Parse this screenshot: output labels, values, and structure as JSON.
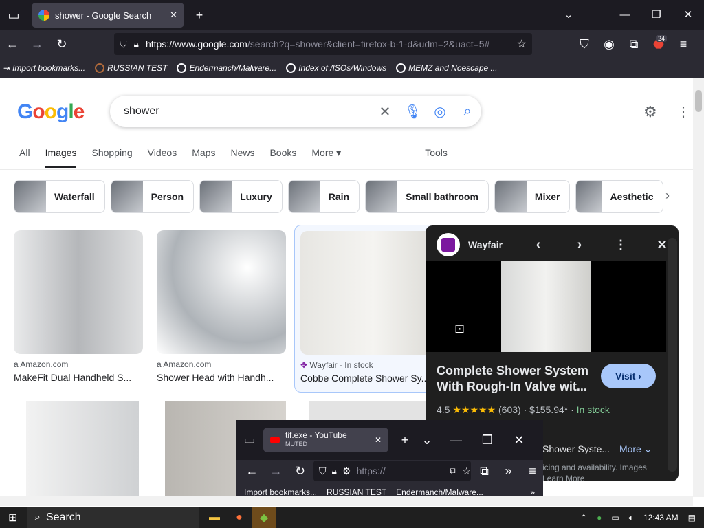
{
  "browser": {
    "tab_title": "shower - Google Search",
    "url_main": "https://www.google.com",
    "url_rest": "/search?q=shower&client=firefox-b-1-d&udm=2&uact=5#",
    "badge_count": "24",
    "bookmarks": [
      "Import bookmarks...",
      "RUSSIAN TEST",
      "Endermanch/Malware...",
      "Index of /ISOs/Windows",
      "MEMZ and Noescape ..."
    ]
  },
  "google": {
    "query": "shower",
    "tabs": [
      "All",
      "Images",
      "Shopping",
      "Videos",
      "Maps",
      "News",
      "Books",
      "More",
      "Tools"
    ],
    "chips": [
      "Waterfall",
      "Person",
      "Luxury",
      "Rain",
      "Small bathroom",
      "Mixer",
      "Aesthetic"
    ],
    "results": [
      {
        "source": "Amazon.com",
        "title": "MakeFit Dual Handheld S..."
      },
      {
        "source": "Amazon.com",
        "title": "Shower Head with Handh..."
      },
      {
        "source": "Wayfair · In stock",
        "title": "Cobbe Complete Shower Sy..."
      }
    ]
  },
  "panel": {
    "site": "Wayfair",
    "title": "Complete Shower System With Rough-In Valve wit...",
    "visit": "Visit",
    "rating": "4.5",
    "stars": "★★★★★",
    "reviews": "(603)",
    "price": "$155.94*",
    "stock": "In stock",
    "snippet": "Shower Syste...",
    "more": "More",
    "pricing_note": "icing and availability. Images",
    "learn_more": "Learn More"
  },
  "mini": {
    "tab_title": "tif.exe - YouTube",
    "muted": "MUTED",
    "url": "https://",
    "bookmarks": [
      "Import bookmarks...",
      "RUSSIAN TEST",
      "Endermanch/Malware..."
    ]
  },
  "taskbar": {
    "search": "Search",
    "time": "12:43 AM"
  }
}
